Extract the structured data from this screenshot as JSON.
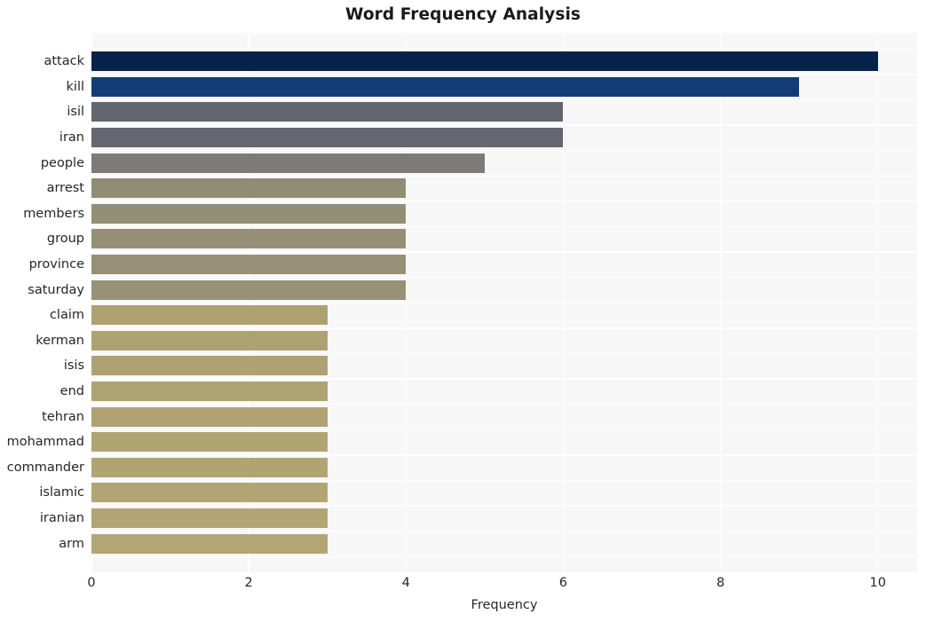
{
  "chart_data": {
    "type": "bar",
    "orientation": "horizontal",
    "title": "Word Frequency Analysis",
    "xlabel": "Frequency",
    "ylabel": "",
    "xlim": [
      0,
      10.5
    ],
    "xticks": [
      0,
      2,
      4,
      6,
      8,
      10
    ],
    "xtick_labels": [
      "0",
      "2",
      "4",
      "6",
      "8",
      "10"
    ],
    "grid": true,
    "grid_color": "#ffffff",
    "plot_background": "#f7f7f7",
    "legend": null,
    "categories": [
      "attack",
      "kill",
      "isil",
      "iran",
      "people",
      "arrest",
      "members",
      "group",
      "province",
      "saturday",
      "claim",
      "kerman",
      "isis",
      "end",
      "tehran",
      "mohammad",
      "commander",
      "islamic",
      "iranian",
      "arm"
    ],
    "values": [
      10,
      9,
      6,
      6,
      5,
      4,
      4,
      4,
      4,
      4,
      3,
      3,
      3,
      3,
      3,
      3,
      3,
      3,
      3,
      3
    ],
    "bar_colors": [
      "#07234b",
      "#123d74",
      "#62666e",
      "#656670",
      "#7c7b78",
      "#918d75",
      "#938e76",
      "#948f76",
      "#959076",
      "#969177",
      "#ada171",
      "#aea272",
      "#afa272",
      "#afa372",
      "#b0a373",
      "#b0a473",
      "#b1a473",
      "#b1a574",
      "#b2a574",
      "#b2a674"
    ]
  }
}
